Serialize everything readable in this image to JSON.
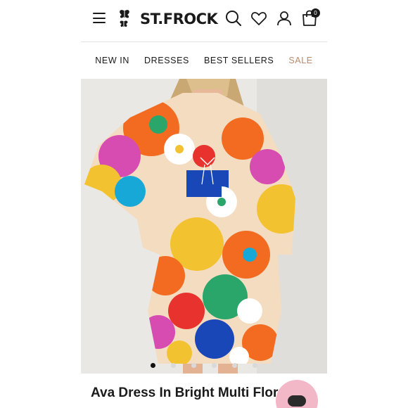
{
  "header": {
    "logo_text": "ST.FROCK",
    "cart_count": "0",
    "icons": [
      "menu-icon",
      "search-icon",
      "heart-icon",
      "account-icon",
      "bag-icon"
    ]
  },
  "nav": {
    "items": [
      {
        "label": "NEW IN"
      },
      {
        "label": "DRESSES"
      },
      {
        "label": "BEST SELLERS"
      },
      {
        "label": "SALE",
        "color": "#b98b6f"
      }
    ]
  },
  "product": {
    "title": "Ava Dress In Bright Multi Floral",
    "gallery_total": 6,
    "gallery_active": 1
  },
  "colors": {
    "accent_sale": "#b98b6f",
    "chat_button": "#f3b8c8"
  }
}
